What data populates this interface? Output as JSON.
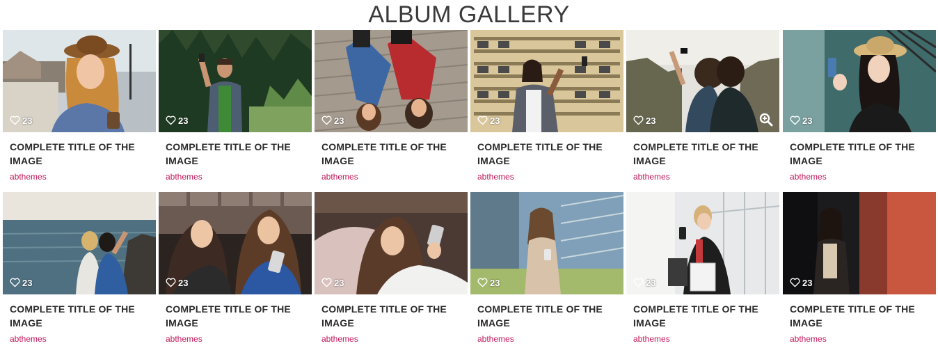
{
  "page": {
    "title": "ALBUM GALLERY"
  },
  "colors": {
    "author": "#c2185b",
    "title": "#2b2b2b",
    "likes": "#ffffff"
  },
  "items": [
    {
      "title": "COMPLETE TITLE OF THE IMAGE",
      "author": "abthemes",
      "likes": "23",
      "scene": "woman-hat-coffee",
      "zoom": false
    },
    {
      "title": "COMPLETE TITLE OF THE IMAGE",
      "author": "abthemes",
      "likes": "23",
      "scene": "man-forest-selfie",
      "zoom": false
    },
    {
      "title": "COMPLETE TITLE OF THE IMAGE",
      "author": "abthemes",
      "likes": "23",
      "scene": "two-women-lying-deck",
      "zoom": false
    },
    {
      "title": "COMPLETE TITLE OF THE IMAGE",
      "author": "abthemes",
      "likes": "23",
      "scene": "woman-building-selfie",
      "zoom": false
    },
    {
      "title": "COMPLETE TITLE OF THE IMAGE",
      "author": "abthemes",
      "likes": "23",
      "scene": "couple-cliff-selfie",
      "zoom": true
    },
    {
      "title": "COMPLETE TITLE OF THE IMAGE",
      "author": "abthemes",
      "likes": "23",
      "scene": "girl-straw-hat-phone",
      "zoom": false
    },
    {
      "title": "COMPLETE TITLE OF THE IMAGE",
      "author": "abthemes",
      "likes": "23",
      "scene": "friends-sea-selfie",
      "zoom": false
    },
    {
      "title": "COMPLETE TITLE OF THE IMAGE",
      "author": "abthemes",
      "likes": "23",
      "scene": "two-women-couch-phone",
      "zoom": false
    },
    {
      "title": "COMPLETE TITLE OF THE IMAGE",
      "author": "abthemes",
      "likes": "23",
      "scene": "woman-pillow-phone",
      "zoom": false
    },
    {
      "title": "COMPLETE TITLE OF THE IMAGE",
      "author": "abthemes",
      "likes": "23",
      "scene": "woman-trench-coat-phone",
      "zoom": false
    },
    {
      "title": "COMPLETE TITLE OF THE IMAGE",
      "author": "abthemes",
      "likes": "23",
      "scene": "woman-shopping-bags-phone",
      "zoom": false
    },
    {
      "title": "COMPLETE TITLE OF THE IMAGE",
      "author": "abthemes",
      "likes": "23",
      "scene": "woman-night-street",
      "zoom": false
    }
  ]
}
